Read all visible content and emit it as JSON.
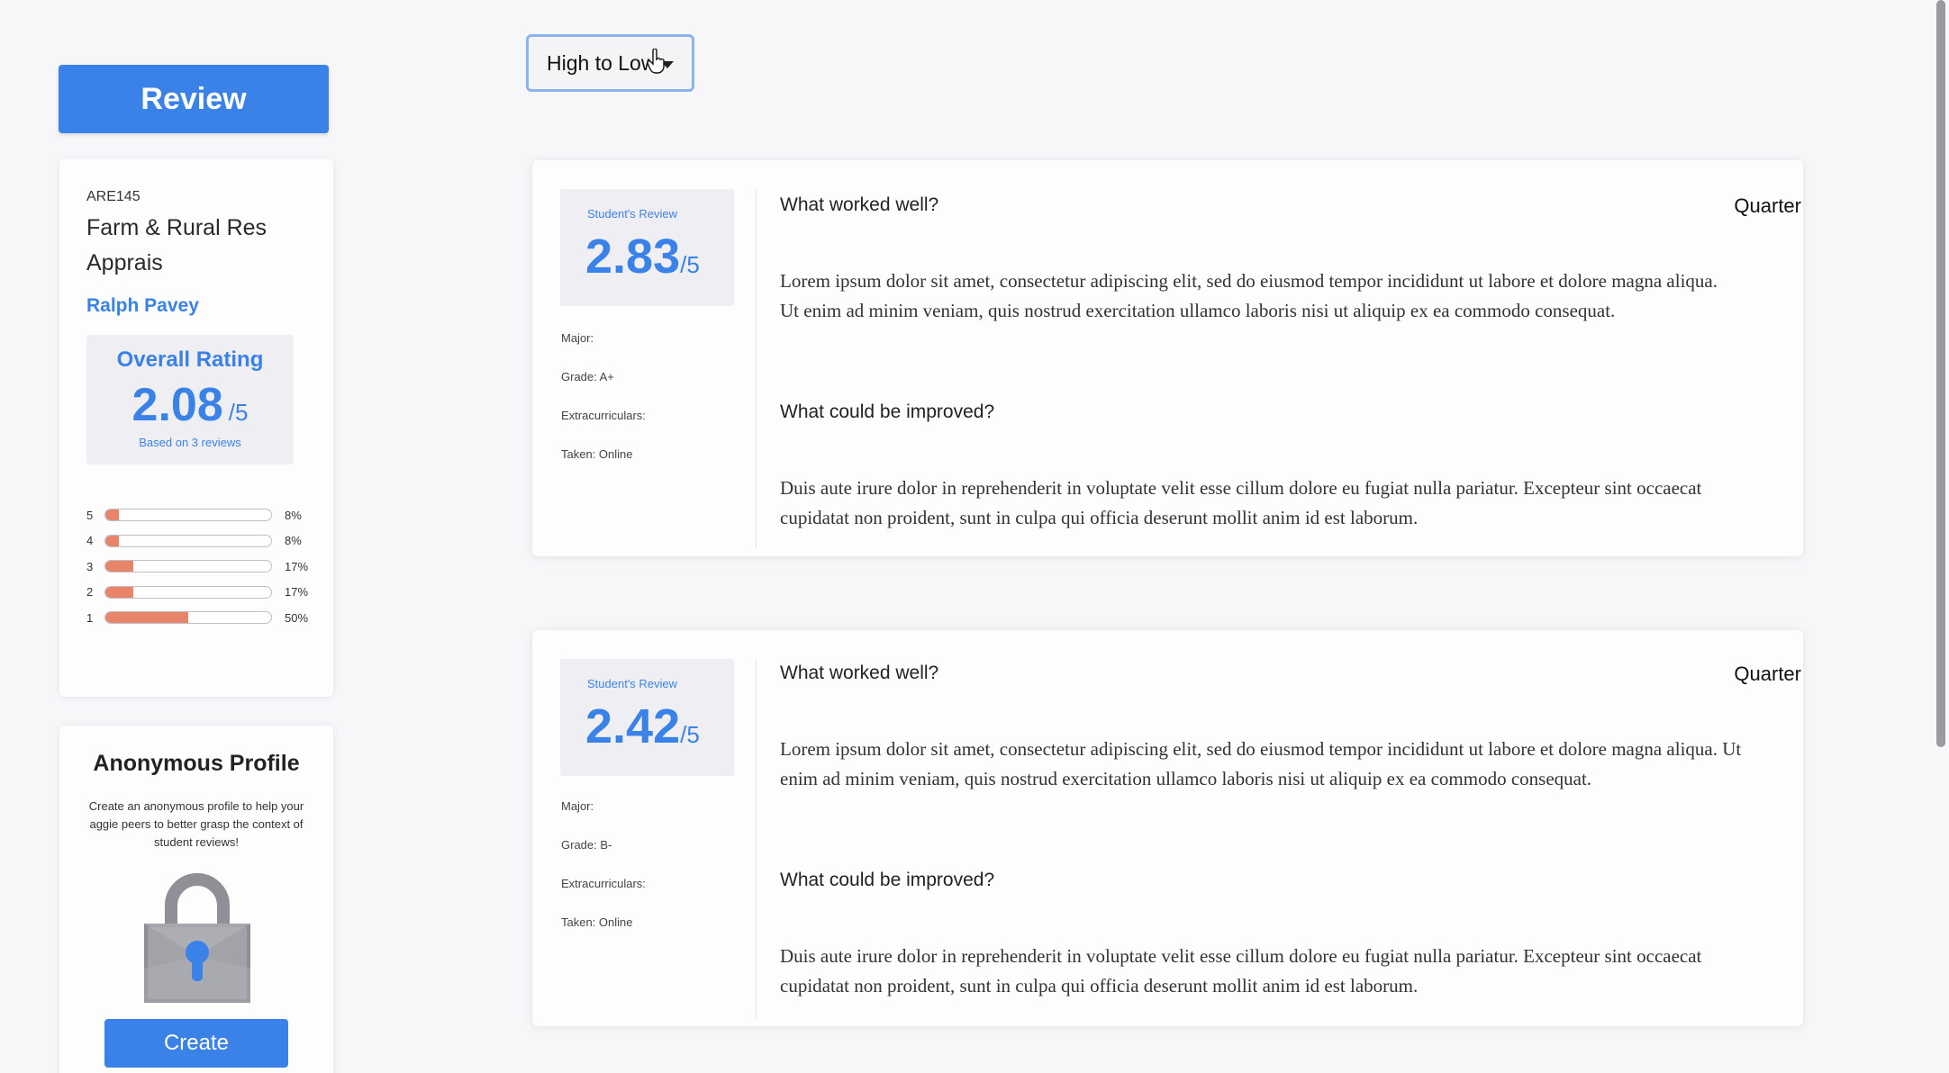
{
  "sidebar": {
    "review_button": "Review",
    "course": {
      "code": "ARE145",
      "name": "Farm & Rural Res Apprais",
      "professor": "Ralph Pavey",
      "overall_title": "Overall Rating",
      "overall_score": "2.08",
      "overall_max": "/5",
      "based_on": "Based on 3 reviews",
      "distribution": [
        {
          "star": "5",
          "pct_label": "8%",
          "pct": 8
        },
        {
          "star": "4",
          "pct_label": "8%",
          "pct": 8
        },
        {
          "star": "3",
          "pct_label": "17%",
          "pct": 17
        },
        {
          "star": "2",
          "pct_label": "17%",
          "pct": 17
        },
        {
          "star": "1",
          "pct_label": "50%",
          "pct": 50
        }
      ]
    },
    "profile": {
      "title": "Anonymous Profile",
      "description": "Create an anonymous profile to help your aggie peers to better grasp the context of student reviews!",
      "create_button": "Create"
    }
  },
  "sort": {
    "selected": "High to Low"
  },
  "reviews": [
    {
      "label": "Student's Review",
      "score": "2.83",
      "max": "/5",
      "major": "Major:",
      "grade": "Grade: A+",
      "extracurriculars": "Extracurriculars:",
      "taken": "Taken: Online",
      "q1": "What worked well?",
      "a1": "Lorem ipsum dolor sit amet, consectetur adipiscing elit, sed do eiusmod tempor incididunt ut labore et dolore magna aliqua. Ut enim ad minim veniam, quis nostrud exercitation ullamco laboris nisi ut aliquip ex ea commodo consequat.",
      "q2": "What could be improved?",
      "a2": "Duis aute irure dolor in reprehenderit in voluptate velit esse cillum dolore eu fugiat nulla pariatur. Excepteur sint occaecat cupidatat non proident, sunt in culpa qui officia deserunt mollit anim id est laborum.",
      "quarter": "Quarter"
    },
    {
      "label": "Student's Review",
      "score": "2.42",
      "max": "/5",
      "major": "Major:",
      "grade": "Grade: B-",
      "extracurriculars": "Extracurriculars:",
      "taken": "Taken: Online",
      "q1": "What worked well?",
      "a1": "Lorem ipsum dolor sit amet, consectetur adipiscing elit, sed do eiusmod tempor incididunt ut labore et dolore magna aliqua. Ut enim ad minim veniam, quis nostrud exercitation ullamco laboris nisi ut aliquip ex ea commodo consequat.",
      "q2": "What could be improved?",
      "a2": "Duis aute irure dolor in reprehenderit in voluptate velit esse cillum dolore eu fugiat nulla pariatur. Excepteur sint occaecat cupidatat non proident, sunt in culpa qui officia deserunt mollit anim id est laborum.",
      "quarter": "Quarter"
    }
  ],
  "colors": {
    "accent": "#3b82e8",
    "bar_fill": "#e8846a",
    "panel": "#eeeef3"
  },
  "icons": {
    "lock": "lock-icon",
    "cursor": "hand-pointer-icon",
    "caret": "chevron-down-icon"
  }
}
